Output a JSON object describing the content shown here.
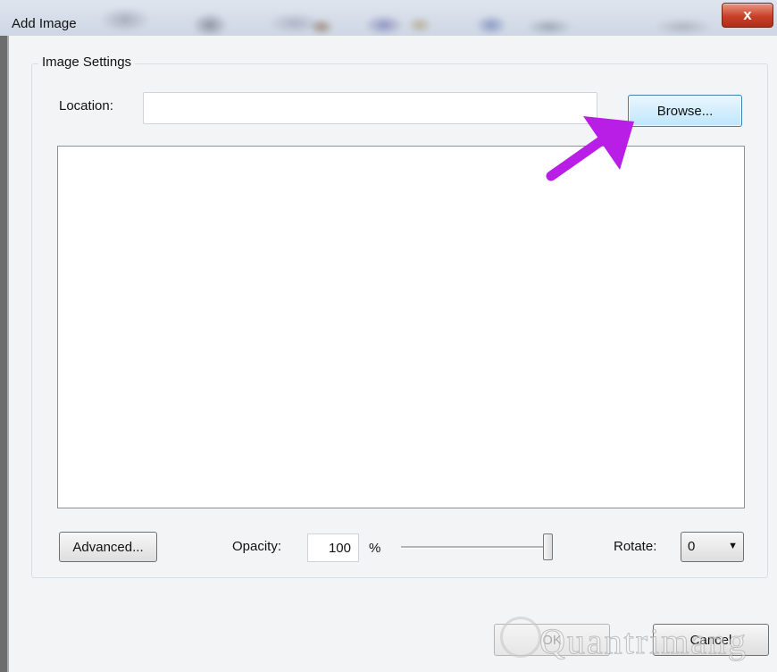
{
  "window": {
    "title": "Add Image",
    "close_glyph": "x"
  },
  "group": {
    "label": "Image Settings"
  },
  "location": {
    "label": "Location:",
    "value": "",
    "browse_label": "Browse..."
  },
  "controls": {
    "advanced_label": "Advanced...",
    "opacity_label": "Opacity:",
    "opacity_value": "100",
    "opacity_unit": "%",
    "opacity_slider_percent": 100,
    "rotate_label": "Rotate:",
    "rotate_value": "0",
    "rotate_arrow": "▼"
  },
  "footer": {
    "ok_label": "OK",
    "cancel_label": "Cancel"
  },
  "watermark": {
    "text": "Quantrimang"
  },
  "annotation": {
    "arrow_color": "#b81ee6",
    "arrow_target": "browse-button"
  }
}
